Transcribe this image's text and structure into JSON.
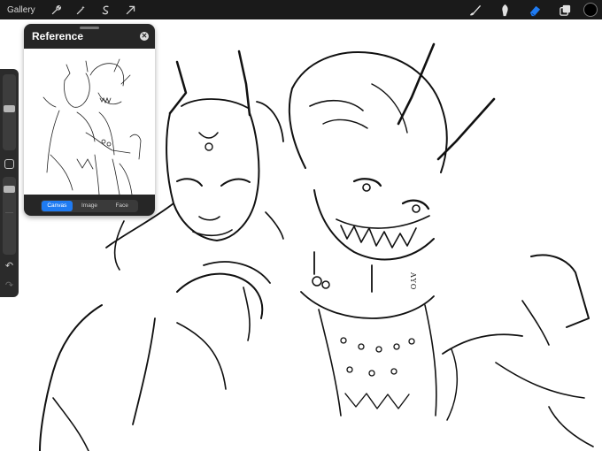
{
  "topbar": {
    "gallery_label": "Gallery",
    "left_tools": [
      "wrench-icon",
      "magic-wand-icon",
      "selection-icon",
      "transform-arrow-icon"
    ],
    "right_tools": [
      "brush-icon",
      "smudge-icon",
      "eraser-icon",
      "layers-icon"
    ],
    "active_tool": "eraser-icon",
    "accent_color": "#1f7bf2",
    "current_color": "#000000"
  },
  "sidebar": {
    "brush_size_level": 0.55,
    "opacity_level": 0.9,
    "undo_icon": "undo-arrow-icon",
    "redo_icon": "redo-arrow-icon"
  },
  "reference_panel": {
    "title": "Reference",
    "tabs": [
      {
        "label": "Canvas",
        "active": true
      },
      {
        "label": "Image",
        "active": false
      },
      {
        "label": "Face",
        "active": false
      }
    ]
  },
  "canvas": {
    "signature_text": "AYO"
  }
}
